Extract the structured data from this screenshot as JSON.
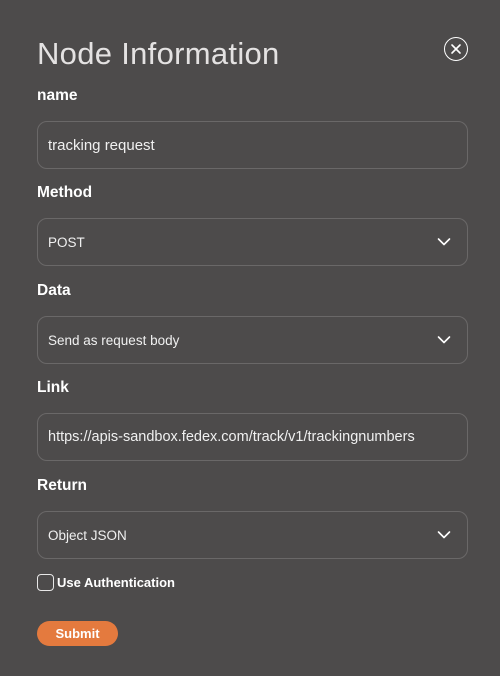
{
  "dialog": {
    "title": "Node Information",
    "close_icon": "close-circle-icon"
  },
  "fields": {
    "name": {
      "label": "name",
      "value": "tracking request"
    },
    "method": {
      "label": "Method",
      "value": "POST"
    },
    "data": {
      "label": "Data",
      "value": "Send as request body"
    },
    "link": {
      "label": "Link",
      "value": "https://apis-sandbox.fedex.com/track/v1/trackingnumbers"
    },
    "return": {
      "label": "Return",
      "value": "Object JSON"
    }
  },
  "auth": {
    "label": "Use Authentication",
    "checked": false
  },
  "submit": {
    "label": "Submit"
  },
  "colors": {
    "background": "#4d4b4b",
    "border": "#6a6868",
    "accent": "#e47a3e",
    "text": "#ffffff"
  }
}
